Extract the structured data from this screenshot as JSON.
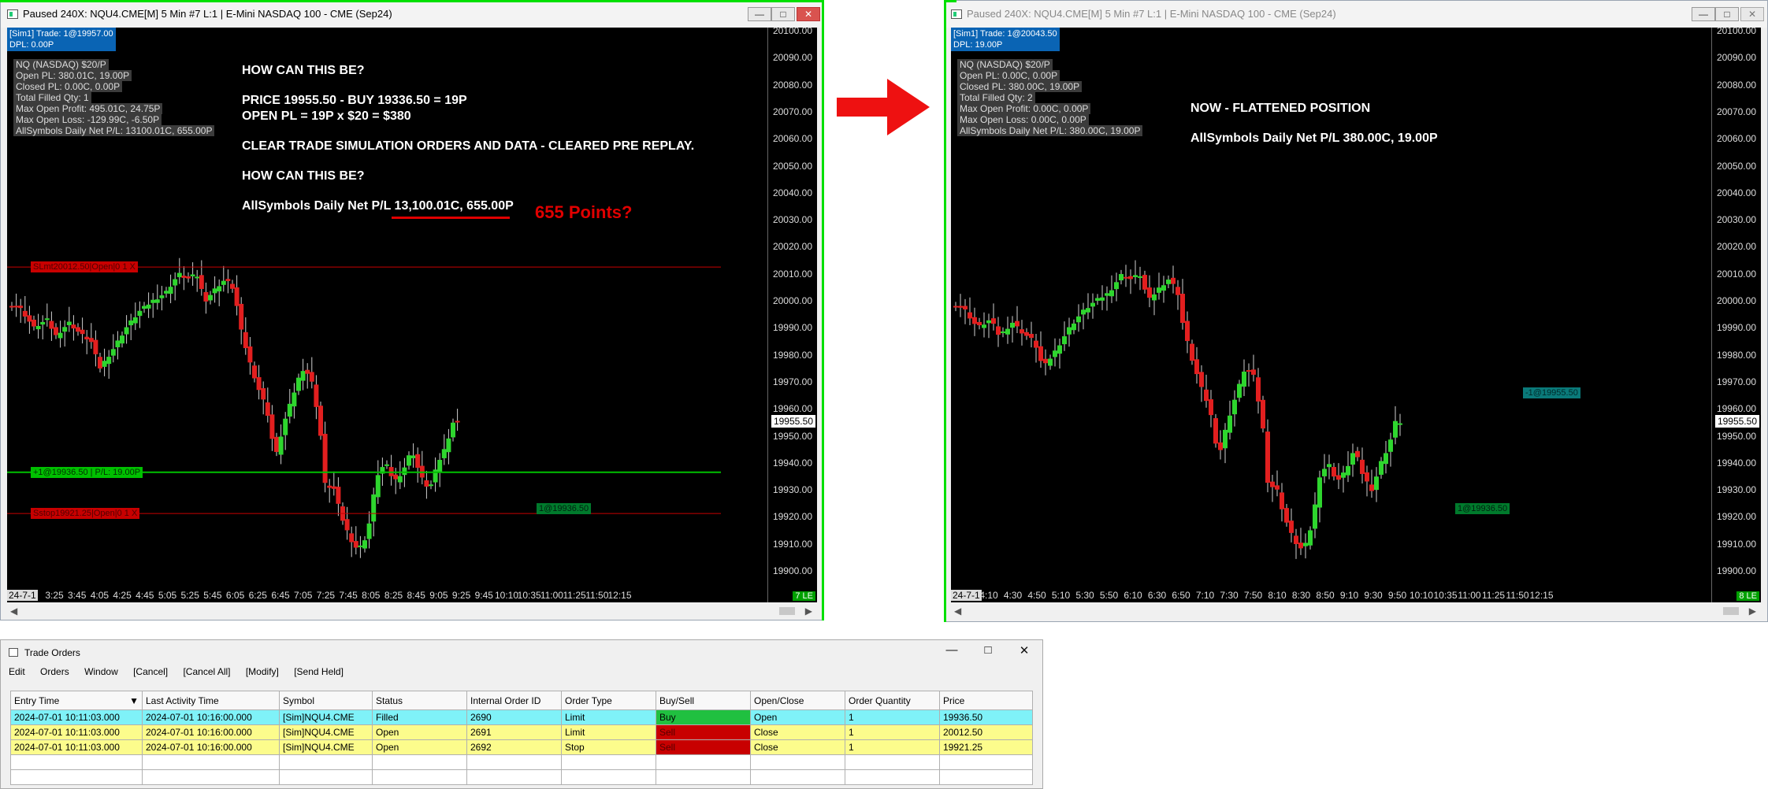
{
  "left_window": {
    "title": "Paused 240X: NQU4.CME[M]  5 Min  #7 L:1 | E-Mini NASDAQ 100 - CME (Sep24)",
    "account": [
      "[Sim1]  Trade: 1@19957.00",
      "DPL: 0.00P"
    ],
    "pl_lines": [
      "NQ (NASDAQ) $20/P",
      "Open PL: 380.01C, 19.00P",
      "Closed PL: 0.00C, 0.00P",
      "Total Filled Qty: 1",
      "Max Open Profit: 495.01C, 24.75P",
      "Max Open Loss: -129.99C, -6.50P",
      "AllSymbols Daily Net P/L: 13100.01C, 655.00P"
    ],
    "notes": [
      "HOW CAN THIS BE?",
      "PRICE 19955.50 - BUY 19336.50 = 19P",
      "OPEN PL = 19P x $20 = $380",
      "CLEAR TRADE SIMULATION ORDERS AND DATA - CLEARED PRE REPLAY.",
      "HOW CAN THIS BE?",
      "AllSymbols Daily Net P/L 13,100.01C, 655.00P"
    ],
    "callout": "655 Points?",
    "order_labels": {
      "limit": "SLmt20012.50|Open|0 1 X",
      "position": "+1@19936.50 | P/L: 19.00P",
      "stop": "Sstop19921.25|Open|0 1 X",
      "fill": "1@19936.50"
    },
    "last_price": "19955.50",
    "corner_badge": "7 LE",
    "first_x_label": "24-7-1",
    "x_labels": [
      "3:25",
      "3:45",
      "4:05",
      "4:25",
      "4:45",
      "5:05",
      "5:25",
      "5:45",
      "6:05",
      "6:25",
      "6:45",
      "7:05",
      "7:25",
      "7:45",
      "8:05",
      "8:25",
      "8:45",
      "9:05",
      "9:25",
      "9:45",
      "10:10",
      "10:35",
      "11:00",
      "11:25",
      "11:50",
      "12:15"
    ],
    "y_labels": [
      "20100.00",
      "20090.00",
      "20080.00",
      "20070.00",
      "20060.00",
      "20050.00",
      "20040.00",
      "20030.00",
      "20020.00",
      "20010.00",
      "20000.00",
      "19990.00",
      "19980.00",
      "19970.00",
      "19960.00",
      "19950.00",
      "19940.00",
      "19930.00",
      "19920.00",
      "19910.00",
      "19900.00"
    ]
  },
  "right_window": {
    "title": "Paused 240X: NQU4.CME[M]  5 Min  #7 L:1 | E-Mini NASDAQ 100 - CME (Sep24)",
    "account": [
      "[Sim1]  Trade: 1@20043.50",
      "DPL: 19.00P"
    ],
    "pl_lines": [
      "NQ (NASDAQ) $20/P",
      "Open PL: 0.00C, 0.00P",
      "Closed PL: 380.00C, 19.00P",
      "Total Filled Qty: 2",
      "Max Open Profit: 0.00C, 0.00P",
      "Max Open Loss: 0.00C, 0.00P",
      "AllSymbols Daily Net P/L: 380.00C, 19.00P"
    ],
    "notes": [
      "NOW - FLATTENED POSITION",
      "AllSymbols Daily Net P/L 380.00C, 19.00P"
    ],
    "order_labels": {
      "exit": "-1@19955.50",
      "fill": "1@19936.50"
    },
    "last_price": "19955.50",
    "corner_badge": "8 LE",
    "first_x_label": "24-7-1",
    "x_labels": [
      "4:10",
      "4:30",
      "4:50",
      "5:10",
      "5:30",
      "5:50",
      "6:10",
      "6:30",
      "6:50",
      "7:10",
      "7:30",
      "7:50",
      "8:10",
      "8:30",
      "8:50",
      "9:10",
      "9:30",
      "9:50",
      "10:10",
      "10:35",
      "11:00",
      "11:25",
      "11:50",
      "12:15"
    ],
    "y_labels": [
      "20100.00",
      "20090.00",
      "20080.00",
      "20070.00",
      "20060.00",
      "20050.00",
      "20040.00",
      "20030.00",
      "20020.00",
      "20010.00",
      "20000.00",
      "19990.00",
      "19980.00",
      "19970.00",
      "19960.00",
      "19950.00",
      "19940.00",
      "19930.00",
      "19920.00",
      "19910.00",
      "19900.00"
    ]
  },
  "trade_orders": {
    "title": "Trade Orders",
    "menu": [
      "Edit",
      "Orders",
      "Window",
      "[Cancel]",
      "[Cancel All]",
      "[Modify]",
      "[Send Held]"
    ],
    "columns": [
      "Entry Time",
      "Last Activity Time",
      "Symbol",
      "Status",
      "Internal Order ID",
      "Order Type",
      "Buy/Sell",
      "Open/Close",
      "Order Quantity",
      "Price"
    ],
    "rows": [
      {
        "entry": "2024-07-01   10:11:03.000",
        "last": "2024-07-01   10:16:00.000",
        "symbol": "[Sim]NQU4.CME",
        "status": "Filled",
        "id": "2690",
        "type": "Limit",
        "side": "Buy",
        "oc": "Open",
        "qty": "1",
        "price": "19936.50"
      },
      {
        "entry": "2024-07-01   10:11:03.000",
        "last": "2024-07-01   10:16:00.000",
        "symbol": "[Sim]NQU4.CME",
        "status": "Open",
        "id": "2691",
        "type": "Limit",
        "side": "Sell",
        "oc": "Close",
        "qty": "1",
        "price": "20012.50"
      },
      {
        "entry": "2024-07-01   10:11:03.000",
        "last": "2024-07-01   10:16:00.000",
        "symbol": "[Sim]NQU4.CME",
        "status": "Open",
        "id": "2692",
        "type": "Stop",
        "side": "Sell",
        "oc": "Close",
        "qty": "1",
        "price": "19921.25"
      }
    ]
  },
  "colors": {
    "up": "#2ed62e",
    "down": "#e21f1f",
    "order_red": "#c80000",
    "position_green": "#00c000",
    "arrow": "#ee1111"
  }
}
